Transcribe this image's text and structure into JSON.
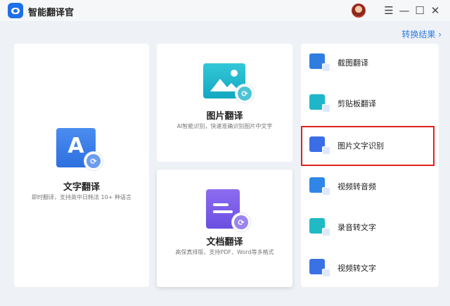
{
  "app": {
    "title": "智能翻译官"
  },
  "window": {
    "minimize": "—",
    "maximize": "☐",
    "close": "✕",
    "menu": "☰"
  },
  "header": {
    "result_link": "转换结果 ›"
  },
  "text_card": {
    "title": "文字翻译",
    "desc": "即时翻译，支持英中日韩法 10+ 种语言",
    "icon_letter": "A"
  },
  "image_card": {
    "title": "图片翻译",
    "desc": "AI智能识别，快速准确识别图片中文字"
  },
  "doc_card": {
    "title": "文档翻译",
    "desc": "高保真排版，支持PDF、Word等多格式"
  },
  "sidebar": {
    "items": [
      {
        "label": "截图翻译",
        "icon": "screenshot-translate-icon",
        "color": "#2f7de1"
      },
      {
        "label": "剪贴板翻译",
        "icon": "clipboard-translate-icon",
        "color": "#1fb6c9"
      },
      {
        "label": "图片文字识别",
        "icon": "image-ocr-icon",
        "color": "#3b6de6"
      },
      {
        "label": "视频转音频",
        "icon": "video-to-audio-icon",
        "color": "#2f86e6"
      },
      {
        "label": "录音转文字",
        "icon": "audio-to-text-icon",
        "color": "#20b9c6"
      },
      {
        "label": "视频转文字",
        "icon": "video-to-text-icon",
        "color": "#3a72e6"
      }
    ]
  },
  "colors": {
    "accent": "#2f7de1",
    "highlight": "#e02020"
  }
}
